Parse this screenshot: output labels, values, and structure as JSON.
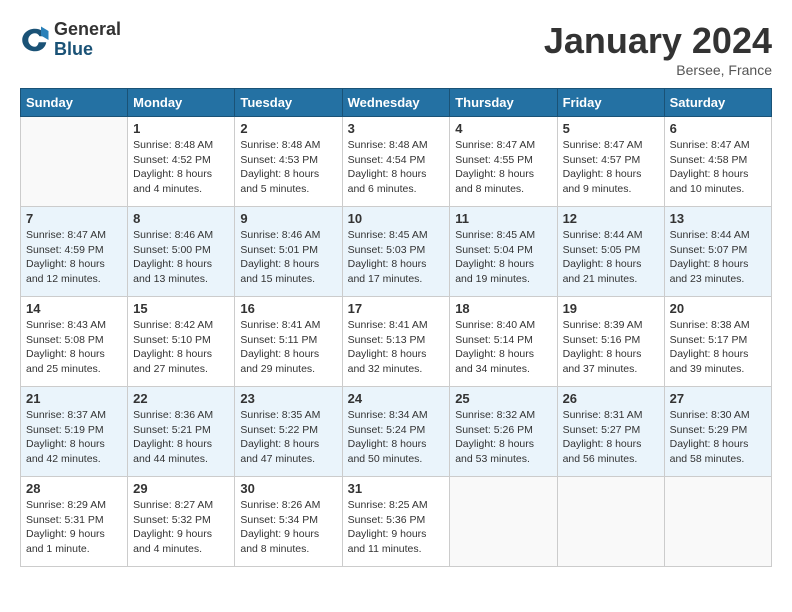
{
  "header": {
    "logo_general": "General",
    "logo_blue": "Blue",
    "month_title": "January 2024",
    "location": "Bersee, France"
  },
  "weekdays": [
    "Sunday",
    "Monday",
    "Tuesday",
    "Wednesday",
    "Thursday",
    "Friday",
    "Saturday"
  ],
  "weeks": [
    [
      {
        "day": "",
        "sunrise": "",
        "sunset": "",
        "daylight": ""
      },
      {
        "day": "1",
        "sunrise": "Sunrise: 8:48 AM",
        "sunset": "Sunset: 4:52 PM",
        "daylight": "Daylight: 8 hours and 4 minutes."
      },
      {
        "day": "2",
        "sunrise": "Sunrise: 8:48 AM",
        "sunset": "Sunset: 4:53 PM",
        "daylight": "Daylight: 8 hours and 5 minutes."
      },
      {
        "day": "3",
        "sunrise": "Sunrise: 8:48 AM",
        "sunset": "Sunset: 4:54 PM",
        "daylight": "Daylight: 8 hours and 6 minutes."
      },
      {
        "day": "4",
        "sunrise": "Sunrise: 8:47 AM",
        "sunset": "Sunset: 4:55 PM",
        "daylight": "Daylight: 8 hours and 8 minutes."
      },
      {
        "day": "5",
        "sunrise": "Sunrise: 8:47 AM",
        "sunset": "Sunset: 4:57 PM",
        "daylight": "Daylight: 8 hours and 9 minutes."
      },
      {
        "day": "6",
        "sunrise": "Sunrise: 8:47 AM",
        "sunset": "Sunset: 4:58 PM",
        "daylight": "Daylight: 8 hours and 10 minutes."
      }
    ],
    [
      {
        "day": "7",
        "sunrise": "Sunrise: 8:47 AM",
        "sunset": "Sunset: 4:59 PM",
        "daylight": "Daylight: 8 hours and 12 minutes."
      },
      {
        "day": "8",
        "sunrise": "Sunrise: 8:46 AM",
        "sunset": "Sunset: 5:00 PM",
        "daylight": "Daylight: 8 hours and 13 minutes."
      },
      {
        "day": "9",
        "sunrise": "Sunrise: 8:46 AM",
        "sunset": "Sunset: 5:01 PM",
        "daylight": "Daylight: 8 hours and 15 minutes."
      },
      {
        "day": "10",
        "sunrise": "Sunrise: 8:45 AM",
        "sunset": "Sunset: 5:03 PM",
        "daylight": "Daylight: 8 hours and 17 minutes."
      },
      {
        "day": "11",
        "sunrise": "Sunrise: 8:45 AM",
        "sunset": "Sunset: 5:04 PM",
        "daylight": "Daylight: 8 hours and 19 minutes."
      },
      {
        "day": "12",
        "sunrise": "Sunrise: 8:44 AM",
        "sunset": "Sunset: 5:05 PM",
        "daylight": "Daylight: 8 hours and 21 minutes."
      },
      {
        "day": "13",
        "sunrise": "Sunrise: 8:44 AM",
        "sunset": "Sunset: 5:07 PM",
        "daylight": "Daylight: 8 hours and 23 minutes."
      }
    ],
    [
      {
        "day": "14",
        "sunrise": "Sunrise: 8:43 AM",
        "sunset": "Sunset: 5:08 PM",
        "daylight": "Daylight: 8 hours and 25 minutes."
      },
      {
        "day": "15",
        "sunrise": "Sunrise: 8:42 AM",
        "sunset": "Sunset: 5:10 PM",
        "daylight": "Daylight: 8 hours and 27 minutes."
      },
      {
        "day": "16",
        "sunrise": "Sunrise: 8:41 AM",
        "sunset": "Sunset: 5:11 PM",
        "daylight": "Daylight: 8 hours and 29 minutes."
      },
      {
        "day": "17",
        "sunrise": "Sunrise: 8:41 AM",
        "sunset": "Sunset: 5:13 PM",
        "daylight": "Daylight: 8 hours and 32 minutes."
      },
      {
        "day": "18",
        "sunrise": "Sunrise: 8:40 AM",
        "sunset": "Sunset: 5:14 PM",
        "daylight": "Daylight: 8 hours and 34 minutes."
      },
      {
        "day": "19",
        "sunrise": "Sunrise: 8:39 AM",
        "sunset": "Sunset: 5:16 PM",
        "daylight": "Daylight: 8 hours and 37 minutes."
      },
      {
        "day": "20",
        "sunrise": "Sunrise: 8:38 AM",
        "sunset": "Sunset: 5:17 PM",
        "daylight": "Daylight: 8 hours and 39 minutes."
      }
    ],
    [
      {
        "day": "21",
        "sunrise": "Sunrise: 8:37 AM",
        "sunset": "Sunset: 5:19 PM",
        "daylight": "Daylight: 8 hours and 42 minutes."
      },
      {
        "day": "22",
        "sunrise": "Sunrise: 8:36 AM",
        "sunset": "Sunset: 5:21 PM",
        "daylight": "Daylight: 8 hours and 44 minutes."
      },
      {
        "day": "23",
        "sunrise": "Sunrise: 8:35 AM",
        "sunset": "Sunset: 5:22 PM",
        "daylight": "Daylight: 8 hours and 47 minutes."
      },
      {
        "day": "24",
        "sunrise": "Sunrise: 8:34 AM",
        "sunset": "Sunset: 5:24 PM",
        "daylight": "Daylight: 8 hours and 50 minutes."
      },
      {
        "day": "25",
        "sunrise": "Sunrise: 8:32 AM",
        "sunset": "Sunset: 5:26 PM",
        "daylight": "Daylight: 8 hours and 53 minutes."
      },
      {
        "day": "26",
        "sunrise": "Sunrise: 8:31 AM",
        "sunset": "Sunset: 5:27 PM",
        "daylight": "Daylight: 8 hours and 56 minutes."
      },
      {
        "day": "27",
        "sunrise": "Sunrise: 8:30 AM",
        "sunset": "Sunset: 5:29 PM",
        "daylight": "Daylight: 8 hours and 58 minutes."
      }
    ],
    [
      {
        "day": "28",
        "sunrise": "Sunrise: 8:29 AM",
        "sunset": "Sunset: 5:31 PM",
        "daylight": "Daylight: 9 hours and 1 minute."
      },
      {
        "day": "29",
        "sunrise": "Sunrise: 8:27 AM",
        "sunset": "Sunset: 5:32 PM",
        "daylight": "Daylight: 9 hours and 4 minutes."
      },
      {
        "day": "30",
        "sunrise": "Sunrise: 8:26 AM",
        "sunset": "Sunset: 5:34 PM",
        "daylight": "Daylight: 9 hours and 8 minutes."
      },
      {
        "day": "31",
        "sunrise": "Sunrise: 8:25 AM",
        "sunset": "Sunset: 5:36 PM",
        "daylight": "Daylight: 9 hours and 11 minutes."
      },
      {
        "day": "",
        "sunrise": "",
        "sunset": "",
        "daylight": ""
      },
      {
        "day": "",
        "sunrise": "",
        "sunset": "",
        "daylight": ""
      },
      {
        "day": "",
        "sunrise": "",
        "sunset": "",
        "daylight": ""
      }
    ]
  ]
}
